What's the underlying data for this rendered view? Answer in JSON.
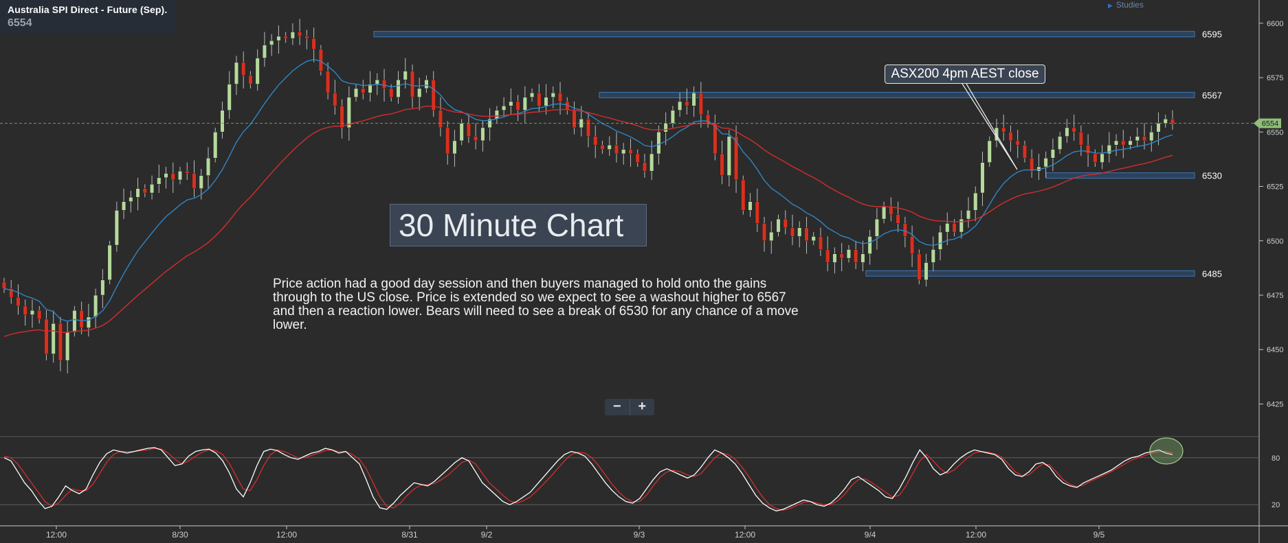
{
  "header": {
    "instrument": "Australia SPI Direct - Future (Sep).",
    "last": "6554"
  },
  "studies_label": "Studies",
  "annotation_title": "30 Minute Chart",
  "commentary": "Price action had a good day session and then buyers managed to hold onto the gains through to the US close. Price is extended so we expect to see a washout higher to 6567 and then a reaction lower. Bears will need to see a break of 6530 for any chance of a move lower.",
  "callout": "ASX200 4pm AEST close",
  "zoom": {
    "minus": "−",
    "plus": "+"
  },
  "colors": {
    "background": "#2b2b2b",
    "bull": "#b5d99c",
    "bear": "#d9301e",
    "ema_fast": "#2f86c7",
    "ema_slow": "#d62d2d",
    "level_band": "#2e5f94",
    "stoch_k": "#ffffff",
    "stoch_d": "#d62d2d",
    "price_tag": "#8fbf7a"
  },
  "chart_data": {
    "type": "candlestick",
    "title": "",
    "ylim": [
      6410,
      6605
    ],
    "y_ticks": [
      6425,
      6450,
      6475,
      6500,
      6525,
      6550,
      6575,
      6600
    ],
    "x_tick_labels": [
      "12:00",
      "8/30",
      "12:00",
      "8/31",
      "9/2",
      "9/3",
      "12:00",
      "9/4",
      "12:00",
      "9/5"
    ],
    "last_price": 6554,
    "levels": [
      {
        "label": "6595",
        "value": 6595
      },
      {
        "label": "6567",
        "value": 6567
      },
      {
        "label": "6530",
        "value": 6530
      },
      {
        "label": "6485",
        "value": 6485
      }
    ],
    "close_path": [
      6478,
      6474,
      6470,
      6466,
      6468,
      6464,
      6448,
      6462,
      6445,
      6458,
      6468,
      6460,
      6465,
      6475,
      6482,
      6498,
      6514,
      6518,
      6520,
      6524,
      6522,
      6526,
      6529,
      6531,
      6528,
      6532,
      6531,
      6524,
      6530,
      6538,
      6550,
      6560,
      6572,
      6582,
      6576,
      6572,
      6584,
      6590,
      6592,
      6594,
      6593,
      6596,
      6594,
      6593,
      6588,
      6578,
      6568,
      6562,
      6552,
      6566,
      6570,
      6568,
      6572,
      6574,
      6570,
      6566,
      6574,
      6578,
      6566,
      6570,
      6574,
      6560,
      6552,
      6540,
      6546,
      6554,
      6548,
      6546,
      6552,
      6556,
      6560,
      6562,
      6564,
      6560,
      6566,
      6568,
      6562,
      6566,
      6568,
      6564,
      6560,
      6552,
      6556,
      6548,
      6544,
      6542,
      6544,
      6540,
      6542,
      6540,
      6536,
      6532,
      6540,
      6550,
      6554,
      6560,
      6564,
      6562,
      6568,
      6558,
      6554,
      6540,
      6530,
      6548,
      6528,
      6514,
      6518,
      6508,
      6500,
      6504,
      6510,
      6506,
      6502,
      6506,
      6500,
      6502,
      6496,
      6490,
      6494,
      6492,
      6496,
      6490,
      6494,
      6502,
      6510,
      6516,
      6512,
      6508,
      6502,
      6494,
      6482,
      6490,
      6496,
      6504,
      6508,
      6504,
      6510,
      6514,
      6522,
      6536,
      6546,
      6552,
      6550,
      6546,
      6544,
      6538,
      6532,
      6534,
      6538,
      6542,
      6548,
      6552,
      6550,
      6544,
      6540,
      6536,
      6540,
      6544,
      6546,
      6544,
      6546,
      6548,
      6546,
      6550,
      6554,
      6556,
      6554
    ],
    "stochastic": {
      "ylim": [
        0,
        100
      ],
      "y_ticks": [
        20,
        80
      ],
      "k": [
        80,
        76,
        62,
        48,
        38,
        25,
        15,
        18,
        30,
        44,
        38,
        34,
        40,
        58,
        74,
        85,
        90,
        88,
        86,
        88,
        90,
        92,
        93,
        90,
        80,
        70,
        72,
        82,
        88,
        90,
        91,
        86,
        76,
        60,
        40,
        30,
        48,
        70,
        88,
        91,
        89,
        84,
        80,
        78,
        82,
        86,
        88,
        92,
        90,
        86,
        88,
        80,
        72,
        52,
        30,
        16,
        14,
        22,
        32,
        40,
        48,
        46,
        44,
        50,
        58,
        66,
        74,
        80,
        76,
        62,
        48,
        40,
        32,
        24,
        20,
        24,
        30,
        36,
        46,
        56,
        66,
        76,
        84,
        88,
        86,
        82,
        72,
        60,
        48,
        38,
        30,
        24,
        22,
        28,
        40,
        52,
        62,
        66,
        62,
        58,
        54,
        58,
        68,
        80,
        90,
        86,
        80,
        72,
        60,
        46,
        32,
        22,
        16,
        12,
        14,
        18,
        22,
        26,
        24,
        20,
        18,
        22,
        30,
        40,
        52,
        56,
        50,
        44,
        38,
        30,
        28,
        40,
        56,
        74,
        90,
        80,
        66,
        58,
        62,
        72,
        80,
        86,
        90,
        88,
        86,
        84,
        78,
        66,
        58,
        56,
        62,
        72,
        74,
        68,
        56,
        48,
        44,
        42,
        48,
        52,
        56,
        60,
        64,
        70,
        76,
        80,
        82,
        86,
        88,
        90,
        86,
        84
      ],
      "d": [
        82,
        80,
        72,
        60,
        48,
        36,
        24,
        18,
        22,
        32,
        40,
        38,
        38,
        46,
        60,
        74,
        84,
        88,
        88,
        88,
        89,
        90,
        92,
        91,
        86,
        78,
        72,
        76,
        82,
        87,
        90,
        89,
        84,
        72,
        56,
        40,
        38,
        52,
        70,
        84,
        90,
        88,
        84,
        80,
        80,
        83,
        86,
        89,
        90,
        88,
        88,
        84,
        78,
        66,
        48,
        30,
        18,
        16,
        22,
        32,
        40,
        45,
        46,
        47,
        52,
        58,
        66,
        74,
        77,
        72,
        60,
        48,
        40,
        32,
        25,
        22,
        25,
        30,
        38,
        47,
        56,
        66,
        76,
        84,
        87,
        86,
        80,
        70,
        58,
        46,
        36,
        28,
        24,
        24,
        32,
        44,
        55,
        62,
        64,
        62,
        58,
        56,
        60,
        70,
        80,
        86,
        84,
        78,
        68,
        56,
        42,
        30,
        20,
        15,
        13,
        15,
        19,
        23,
        24,
        22,
        20,
        20,
        25,
        33,
        44,
        52,
        53,
        48,
        42,
        36,
        30,
        32,
        44,
        60,
        76,
        84,
        76,
        66,
        60,
        64,
        72,
        80,
        86,
        88,
        87,
        85,
        81,
        72,
        62,
        57,
        58,
        66,
        72,
        71,
        62,
        52,
        46,
        43,
        45,
        50,
        54,
        58,
        62,
        67,
        72,
        77,
        80,
        83,
        86,
        88,
        88,
        86
      ]
    }
  }
}
